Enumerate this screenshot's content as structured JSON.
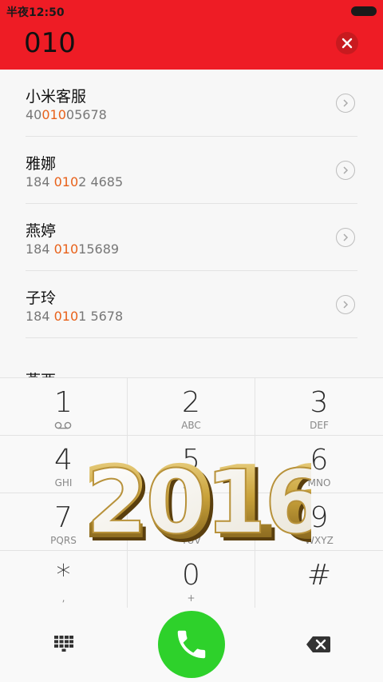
{
  "status_bar": {
    "time": "半夜12:50"
  },
  "dialer": {
    "input": "010"
  },
  "contacts": [
    {
      "name": "小米客服",
      "number_pre": "40",
      "number_hl": "010",
      "number_post": "05678"
    },
    {
      "name": "雅娜",
      "number_pre": "184 ",
      "number_hl": "010",
      "number_post": "2 4685"
    },
    {
      "name": "燕婷",
      "number_pre": "184 ",
      "number_hl": "010",
      "number_post": "15689"
    },
    {
      "name": "子玲",
      "number_pre": "184 ",
      "number_hl": "010",
      "number_post": "1 5678"
    }
  ],
  "partial_contact": {
    "name": "燕西"
  },
  "keypad": [
    {
      "digit": "1",
      "letters": ""
    },
    {
      "digit": "2",
      "letters": "ABC"
    },
    {
      "digit": "3",
      "letters": "DEF"
    },
    {
      "digit": "4",
      "letters": "GHI"
    },
    {
      "digit": "5",
      "letters": "JKL"
    },
    {
      "digit": "6",
      "letters": "MNO"
    },
    {
      "digit": "7",
      "letters": "PQRS"
    },
    {
      "digit": "8",
      "letters": "TUV"
    },
    {
      "digit": "9",
      "letters": "WXYZ"
    },
    {
      "digit": "*",
      "letters": ","
    },
    {
      "digit": "0",
      "letters": "+"
    },
    {
      "digit": "#",
      "letters": ""
    }
  ],
  "overlay": {
    "text": "2016"
  },
  "colors": {
    "header": "#ee1c25",
    "highlight": "#e8611a",
    "call": "#2ed12b",
    "gold": "#c9a23a"
  },
  "icons": {
    "voicemail": "voicemail-icon",
    "clear": "clear-icon",
    "arrow": "chevron-right-icon",
    "grid": "dialpad-grid-icon",
    "call": "phone-icon",
    "backspace": "backspace-icon"
  }
}
